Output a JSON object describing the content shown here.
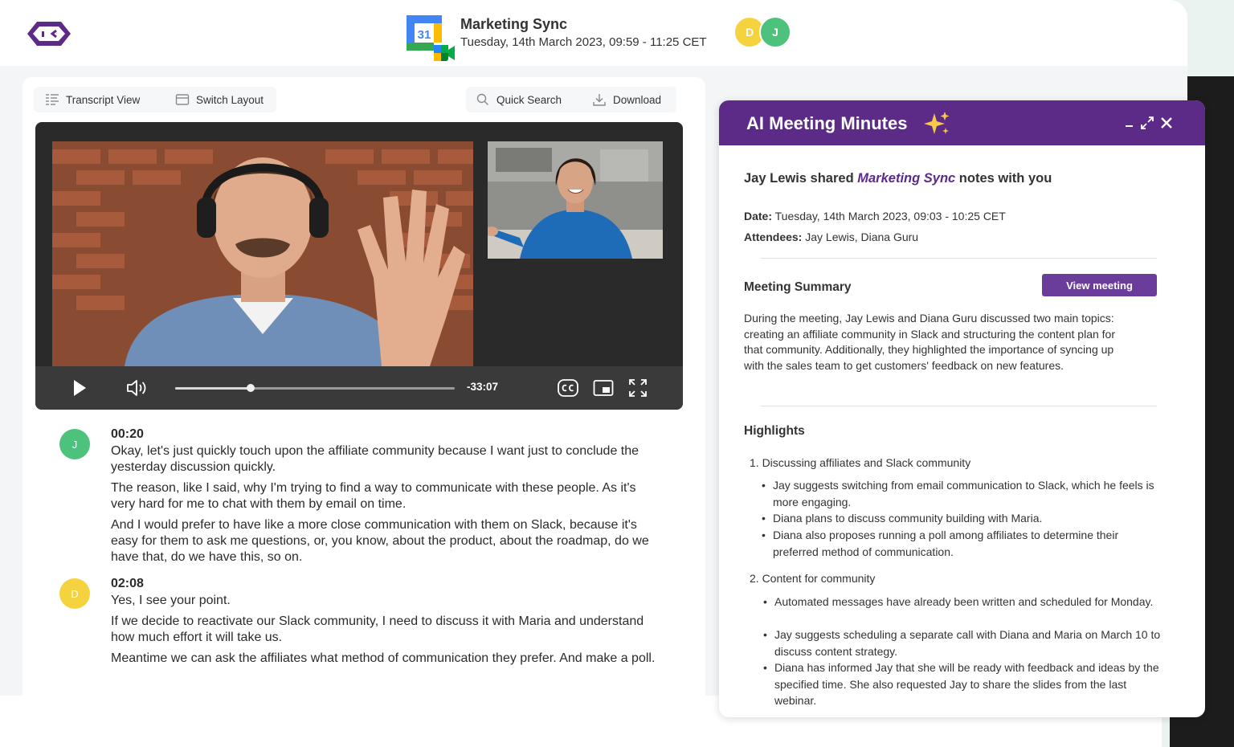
{
  "header": {
    "meeting_title": "Marketing Sync",
    "meeting_datetime": "Tuesday, 14th March 2023, 09:59 - 11:25 CET",
    "calendar_day": "31",
    "participants": [
      {
        "initial": "D",
        "color": "#f5d33f"
      },
      {
        "initial": "J",
        "color": "#4cc27c"
      }
    ]
  },
  "toolbar": {
    "transcript_view": "Transcript View",
    "switch_layout": "Switch Layout",
    "quick_search": "Quick Search",
    "download": "Download"
  },
  "player": {
    "time_remaining": "-33:07",
    "progress": 0.27,
    "icons": [
      "play-icon",
      "volume-icon",
      "captions-icon",
      "picture-in-picture-icon",
      "fullscreen-icon"
    ]
  },
  "transcript": [
    {
      "speaker_initial": "J",
      "color": "#4cc27c",
      "time": "00:20",
      "paragraphs": [
        "Okay, let's just quickly touch upon the affiliate community because I want just to conclude the yesterday discussion quickly.",
        "The reason, like I said, why I'm trying to find a way to communicate with these people. As it's very hard for me to chat with them by email on time.",
        "And I would prefer to have like a more close communication with them on Slack, because it's easy for them to ask me questions, or, you know, about the product, about the roadmap, do we have that, do we have this, so on."
      ]
    },
    {
      "speaker_initial": "D",
      "color": "#f5d33f",
      "time": "02:08",
      "paragraphs": [
        "Yes, I see your point.",
        "If we decide to reactivate our Slack community, I need to discuss it with Maria and understand how much effort it will take us.",
        "Meantime we can ask the affiliates what method of communication they prefer. And make a poll."
      ]
    }
  ],
  "minutes": {
    "title": "AI Meeting Minutes",
    "shared_prefix": "Jay Lewis shared ",
    "shared_meeting": "Marketing Sync",
    "shared_suffix": " notes with you",
    "date_label": "Date:",
    "date_value": " Tuesday, 14th March 2023, 09:03 - 10:25 CET",
    "attendees_label": "Attendees:",
    "attendees_value": " Jay Lewis, Diana Guru",
    "summary_title": "Meeting Summary",
    "view_meeting": "View meeting",
    "summary_text": "During the meeting, Jay Lewis and Diana Guru discussed two main topics: creating an affiliate community in Slack and structuring the content plan for that community. Additionally, they highlighted the importance of syncing up with the sales team to get customers' feedback on new features.",
    "highlights_title": "Highlights",
    "highlights": [
      {
        "heading": "1. Discussing affiliates and Slack community",
        "bullets": [
          "Jay suggests switching from email communication to Slack, which he feels is more engaging.",
          "Diana plans to discuss community building with Maria.",
          "Diana also proposes running a poll among affiliates to determine their preferred method of communication."
        ]
      },
      {
        "heading": "2. Content for community",
        "bullets": [
          "Automated messages have already been written and scheduled for Monday.",
          "Jay suggests scheduling a separate call with Diana and Maria on March 10 to discuss content strategy.",
          "Diana has informed Jay that she will be ready with feedback and ideas by the specified time. She also requested Jay to share the slides from the last webinar."
        ]
      }
    ]
  },
  "colors": {
    "brand_purple": "#5b2b87",
    "button_purple": "#6a3d9a",
    "green": "#4cc27c",
    "yellow": "#f5d33f"
  }
}
